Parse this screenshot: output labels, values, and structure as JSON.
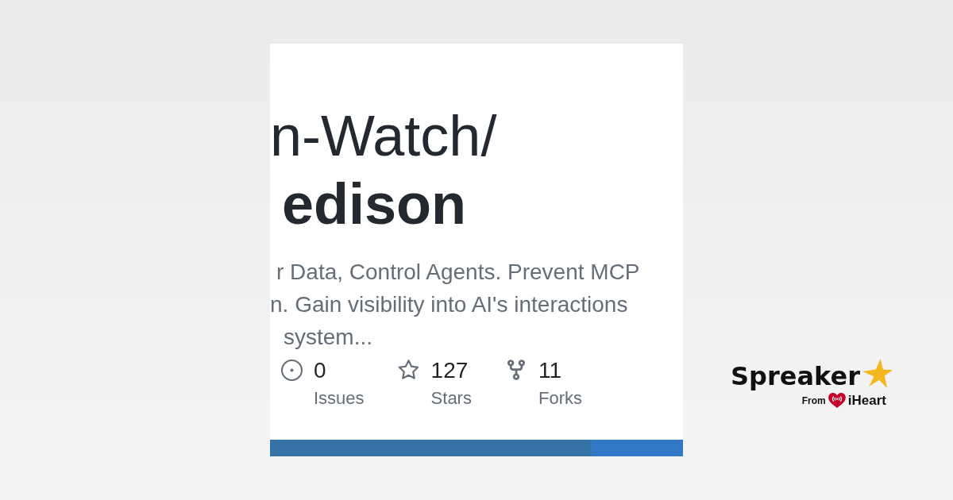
{
  "repo_card": {
    "owner": "n-Watch/",
    "name": "edison",
    "description_lines": [
      "r Data, Control Agents. Prevent MCP",
      "n. Gain visibility into AI's interactions",
      "system..."
    ],
    "stats": [
      {
        "kind": "issues",
        "count": "0",
        "label": "Issues"
      },
      {
        "kind": "stars",
        "count": "127",
        "label": "Stars"
      },
      {
        "kind": "forks",
        "count": "11",
        "label": "Forks"
      }
    ],
    "language_bar": [
      {
        "color": "#3572a5",
        "level": 0.777
      },
      {
        "color": "#3178c6",
        "level": 0.223
      }
    ]
  },
  "brand": {
    "name": "Spreaker",
    "from": "From",
    "partner": "iHeart"
  }
}
